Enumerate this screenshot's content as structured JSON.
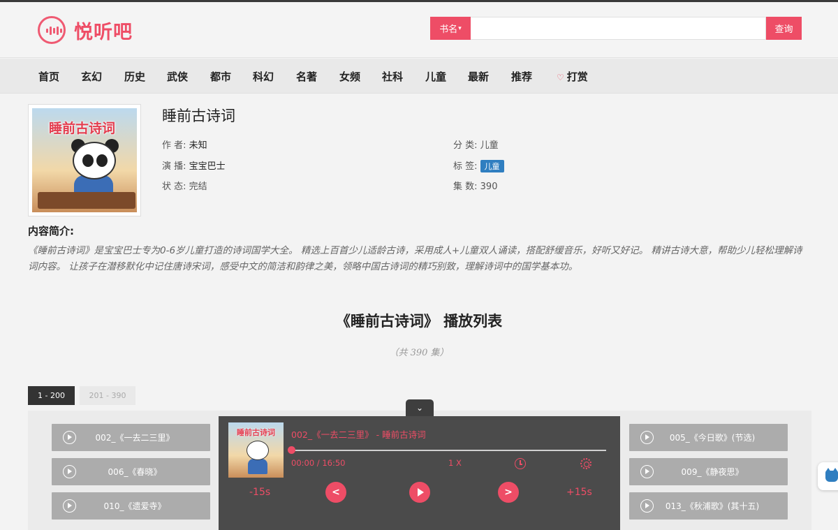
{
  "brand": {
    "name": "悦听吧"
  },
  "search": {
    "type_label": "书名",
    "placeholder": "",
    "value": "",
    "submit_label": "查询"
  },
  "nav": [
    {
      "label": "首页"
    },
    {
      "label": "玄幻"
    },
    {
      "label": "历史"
    },
    {
      "label": "武侠"
    },
    {
      "label": "都市"
    },
    {
      "label": "科幻"
    },
    {
      "label": "名著"
    },
    {
      "label": "女频"
    },
    {
      "label": "社科"
    },
    {
      "label": "儿童"
    },
    {
      "label": "最新"
    },
    {
      "label": "推荐"
    },
    {
      "label": "打赏"
    }
  ],
  "book": {
    "cover_text": "睡前古诗词",
    "title": "睡前古诗词",
    "author_label": "作 者:",
    "author": "未知",
    "narrator_label": "演 播:",
    "narrator": "宝宝巴士",
    "status_label": "状 态:",
    "status": "完结",
    "category_label": "分 类:",
    "category": "儿童",
    "tags_label": "标 签:",
    "tag": "儿童",
    "episodes_label": "集 数:",
    "episodes": "390"
  },
  "intro": {
    "heading": "内容简介:",
    "text": "《睡前古诗词》是宝宝巴士专为0-6岁儿童打造的诗词国学大全。 精选上百首少儿适龄古诗，采用成人+儿童双人诵读，搭配舒缓音乐，好听又好记。 精讲古诗大意，帮助少儿轻松理解诗词内容。 让孩子在潜移默化中记住唐诗宋词，感受中文的简洁和韵律之美，领略中国古诗词的精巧别致，理解诗词中的国学基本功。"
  },
  "playlist": {
    "title": "《睡前古诗词》 播放列表",
    "count": "（共 390 集）",
    "tabs": [
      {
        "label": "1 - 200"
      },
      {
        "label": "201 - 390"
      }
    ],
    "episodes": [
      {
        "title": "002_《一去二三里》"
      },
      {
        "title": "005_《今日歌》(节选)"
      },
      {
        "title": "006_《春晓》"
      },
      {
        "title": "009_《静夜思》"
      },
      {
        "title": "010_《遗爱寺》"
      },
      {
        "title": "013_《秋浦歌》(其十五)"
      }
    ]
  },
  "player": {
    "toggle_icon": "chevron-down-icon",
    "cover_text": "睡前古诗词",
    "track": "002_《一去二三里》 - 睡前古诗词",
    "time": "00:00 / 16:50",
    "progress": 0,
    "speed": "1 X",
    "rewind": "-15s",
    "forward": "+15s",
    "prev_icon": "<",
    "next_icon": ">"
  },
  "colors": {
    "accent": "#ee4d66",
    "tag": "#2f7ec0",
    "player_bg": "#3e3e3e"
  }
}
